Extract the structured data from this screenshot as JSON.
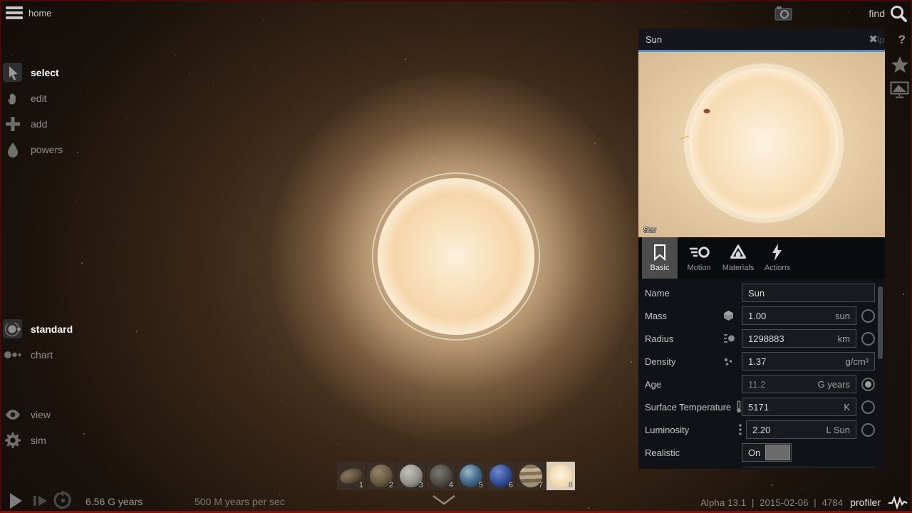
{
  "topbar": {
    "home_label": "home",
    "find_label": "find"
  },
  "sidebar": {
    "tools": [
      {
        "label": "select",
        "selected": true
      },
      {
        "label": "edit",
        "selected": false
      },
      {
        "label": "add",
        "selected": false
      },
      {
        "label": "powers",
        "selected": false
      }
    ],
    "modes": [
      {
        "label": "standard",
        "selected": true
      },
      {
        "label": "chart",
        "selected": false
      }
    ],
    "settings": [
      {
        "label": "view"
      },
      {
        "label": "sim"
      }
    ]
  },
  "panel": {
    "title": "Sun",
    "preview_tag": "Star",
    "tabs": [
      {
        "label": "Basic",
        "selected": true
      },
      {
        "label": "Motion",
        "selected": false
      },
      {
        "label": "Materials",
        "selected": false
      },
      {
        "label": "Actions",
        "selected": false
      }
    ],
    "rows": [
      {
        "label": "Name",
        "value": "Sun",
        "unit": ""
      },
      {
        "label": "Mass",
        "value": "1.00",
        "unit": "sun",
        "radio": "off"
      },
      {
        "label": "Radius",
        "value": "1298883",
        "unit": "km",
        "radio": "off"
      },
      {
        "label": "Density",
        "value": "1.37",
        "unit": "g/cm³"
      },
      {
        "label": "Age",
        "value": "11.2",
        "unit": "G years",
        "radio": "on"
      },
      {
        "label": "Surface Temperature",
        "value": "5171",
        "unit": "K",
        "radio": "off"
      },
      {
        "label": "Luminosity",
        "value": "2.20",
        "unit": "L Sun",
        "radio": "off"
      },
      {
        "label": "Realistic",
        "value": "On",
        "type": "toggle"
      }
    ]
  },
  "right_rail": {
    "help_icon": "?",
    "help_partial": "lp"
  },
  "timebar": {
    "elapsed": "6.56 G years",
    "rate": "500 M years per sec"
  },
  "statusbar": {
    "version": "Alpha 13.1",
    "separator": "|",
    "date": "2015-02-06",
    "build": "4784",
    "profiler_label": "profiler"
  },
  "thumbnails": [
    {
      "label": "1",
      "name": "asteroid"
    },
    {
      "label": "2",
      "name": "rocky-moon"
    },
    {
      "label": "3",
      "name": "gray-moon"
    },
    {
      "label": "4",
      "name": "cratered-planet"
    },
    {
      "label": "5",
      "name": "earth-like-planet"
    },
    {
      "label": "6",
      "name": "blue-planet"
    },
    {
      "label": "7",
      "name": "gas-giant"
    },
    {
      "label": "8",
      "name": "star",
      "selected": true
    }
  ],
  "colors": {
    "accent_blue": "#5b8ac2",
    "frame_red": "#7e120b",
    "selection_bg": "#4c4c4c"
  }
}
